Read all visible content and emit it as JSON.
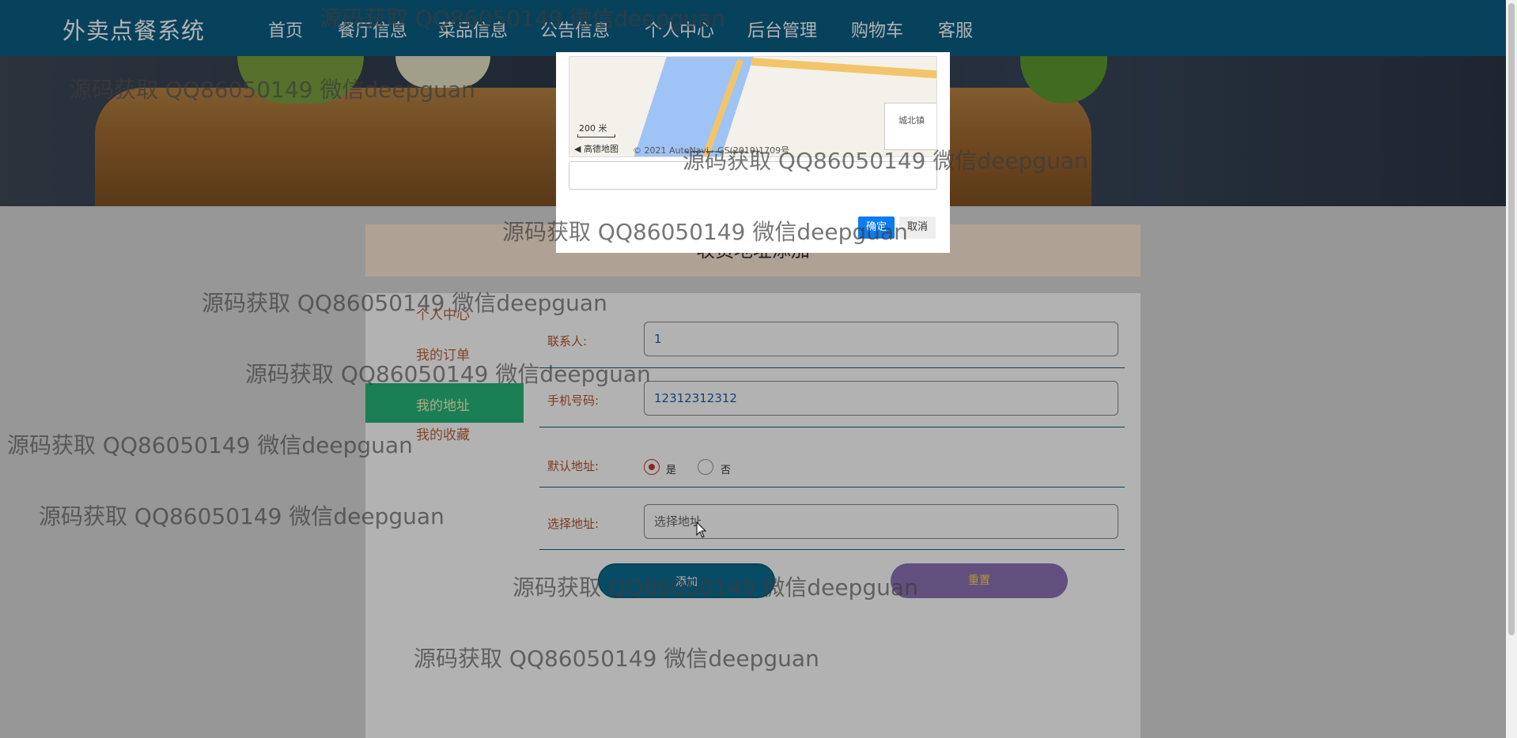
{
  "nav": {
    "brand": "外卖点餐系统",
    "items": [
      "首页",
      "餐厅信息",
      "菜品信息",
      "公告信息",
      "个人中心",
      "后台管理",
      "购物车",
      "客服"
    ],
    "active_index": 4
  },
  "page": {
    "title": "收货地址添加"
  },
  "sidebar": {
    "items": [
      "个人中心",
      "我的订单",
      "我的地址",
      "我的收藏"
    ],
    "active_index": 2
  },
  "form": {
    "contact_label": "联系人:",
    "contact_value": "1",
    "phone_label": "手机号码:",
    "phone_value": "12312312312",
    "default_label": "默认地址:",
    "default_yes": "是",
    "default_no": "否",
    "default_selected": "是",
    "address_label": "选择地址:",
    "address_placeholder": "选择地址",
    "add_button": "添加",
    "reset_button": "重置"
  },
  "dialog": {
    "map_scale": "200 米",
    "map_logo": "高德地图",
    "map_copyright": "© 2021 AutoNavi - GS(2019)1709号",
    "map_place": "城北镇",
    "confirm_button": "确定",
    "cancel_button": "取消"
  },
  "watermark": {
    "text": "源码获取 QQ86050149 微信deepguan"
  },
  "colors": {
    "nav_bg": "#0b5f86",
    "sidebar_active": "#27b67a",
    "add_button": "#0b6e93",
    "reset_button": "#8b73b5",
    "confirm_button": "#0d7cf2"
  }
}
